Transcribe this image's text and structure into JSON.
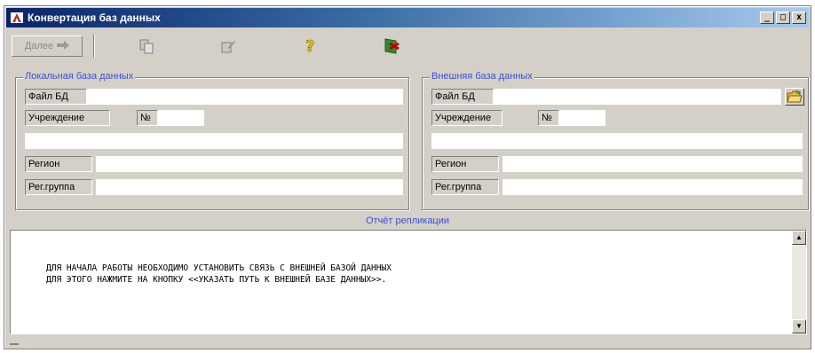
{
  "window": {
    "title": "Конвертация баз данных",
    "controls": {
      "minimize": "_",
      "maximize": "□",
      "close": "x"
    }
  },
  "toolbar": {
    "next_label": "Далее",
    "icons": [
      "copy-db-icon",
      "edit-db-icon",
      "help-icon",
      "exit-icon"
    ]
  },
  "local_db": {
    "legend": "Локальная база данных",
    "file_label": "Файл БД",
    "file_value": "",
    "institution_label": "Учреждение",
    "number_label": "№",
    "number_value": "",
    "institution_name": "",
    "region_label": "Регион",
    "region_value": "",
    "reg_group_label": "Рег.группа",
    "reg_group_value": ""
  },
  "external_db": {
    "legend": "Внешняя база данных",
    "file_label": "Файл БД",
    "file_value": "",
    "institution_label": "Учреждение",
    "number_label": "№",
    "number_value": "",
    "institution_name": "",
    "region_label": "Регион",
    "region_value": "",
    "reg_group_label": "Рег.группа",
    "reg_group_value": ""
  },
  "report": {
    "title": "Отчёт репликации",
    "lines": [
      "ДЛЯ НАЧАЛА РАБОТЫ НЕОБХОДИМО УСТАНОВИТЬ СВЯЗЬ С ВНЕШНЕЙ БАЗОЙ ДАННЫХ",
      "ДЛЯ ЭТОГО НАЖМИТЕ НА КНОПКУ <<УКАЗАТЬ ПУТЬ К ВНЕШНЕЙ БАЗЕ ДАННЫХ>>."
    ]
  },
  "colors": {
    "title_bar": "#0a246a",
    "face": "#d4d0c8",
    "legend_text": "#3b4fd8"
  }
}
